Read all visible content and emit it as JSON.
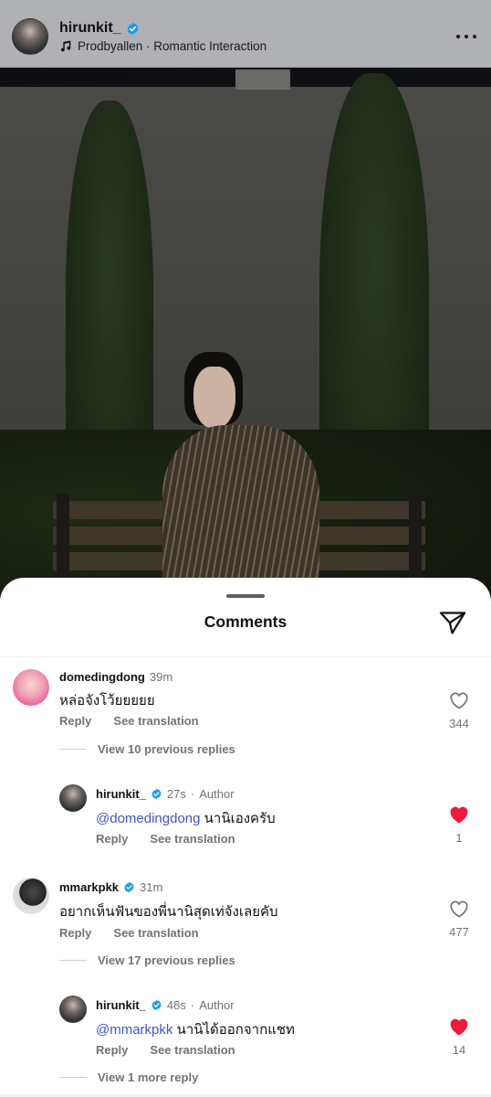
{
  "post": {
    "username": "hirunkit_",
    "music": "Prodbyallen · Romantic Interaction"
  },
  "sheet": {
    "title": "Comments"
  },
  "comments": [
    {
      "username": "domedingdong",
      "time": "39m",
      "text": "หล่อจังโว้ยยยยย",
      "reply_label": "Reply",
      "translate_label": "See translation",
      "likes": "344",
      "liked": false,
      "view_replies": "View 10 previous replies"
    },
    {
      "username": "hirunkit_",
      "time": "27s",
      "author_label": "Author",
      "mention": "@domedingdong",
      "text": "นานิเองครับ",
      "reply_label": "Reply",
      "translate_label": "See translation",
      "likes": "1",
      "liked": true
    },
    {
      "username": "mmarkpkk",
      "time": "31m",
      "text": "อยากเห็นฟันของพี่นานิสุดเท่จังเลยคับ",
      "reply_label": "Reply",
      "translate_label": "See translation",
      "likes": "477",
      "liked": false,
      "view_replies": "View 17 previous replies"
    },
    {
      "username": "hirunkit_",
      "time": "48s",
      "author_label": "Author",
      "mention": "@mmarkpkk",
      "text": "นานิได้ออกจากแชท",
      "reply_label": "Reply",
      "translate_label": "See translation",
      "likes": "14",
      "liked": true,
      "view_replies": "View 1 more reply"
    }
  ],
  "colors": {
    "verified": "#1d9bf0",
    "liked": "#ed1c3a",
    "mention": "#3e55c9",
    "muted": "#737373"
  },
  "icons": {
    "music": "music-note-icon",
    "more": "more-horizontal-icon",
    "share": "paper-plane-icon",
    "like": "heart-icon",
    "verified": "verified-badge-icon"
  }
}
